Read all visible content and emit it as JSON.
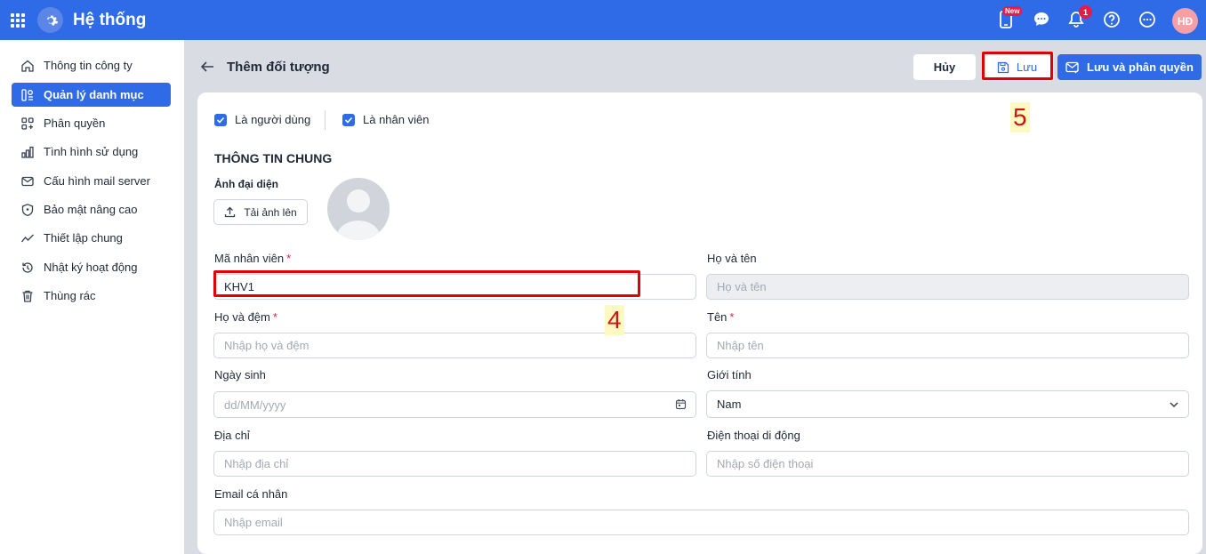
{
  "topbar": {
    "title": "Hệ thống",
    "new_badge": "New",
    "notification_count": "1",
    "user_initials": "HĐ"
  },
  "sidebar": {
    "items": [
      {
        "label": "Thông tin công ty",
        "icon": "home-icon"
      },
      {
        "label": "Quản lý danh mục",
        "icon": "category-icon",
        "active": true
      },
      {
        "label": "Phân quyền",
        "icon": "grid-plus-icon"
      },
      {
        "label": "Tình hình sử dụng",
        "icon": "bar-chart-icon"
      },
      {
        "label": "Cấu hình mail server",
        "icon": "mail-icon"
      },
      {
        "label": "Bảo mật nâng cao",
        "icon": "shield-icon"
      },
      {
        "label": "Thiết lập chung",
        "icon": "trend-icon"
      },
      {
        "label": "Nhật ký hoạt động",
        "icon": "history-icon"
      },
      {
        "label": "Thùng rác",
        "icon": "trash-icon"
      }
    ]
  },
  "header": {
    "title": "Thêm đối tượng",
    "cancel_label": "Hủy",
    "save_label": "Lưu",
    "save_perm_label": "Lưu và phân quyền"
  },
  "annotations": {
    "step4": "4",
    "step5": "5"
  },
  "form": {
    "is_user_label": "Là người dùng",
    "is_employee_label": "Là nhân viên",
    "is_user_checked": true,
    "is_employee_checked": true,
    "section_title": "THÔNG TIN CHUNG",
    "avatar_label": "Ảnh đại diện",
    "upload_label": "Tải ảnh lên",
    "employee_code": {
      "label": "Mã nhân viên",
      "value": "KHV1"
    },
    "full_name": {
      "label": "Họ và tên",
      "placeholder": "Họ và tên"
    },
    "last_middle_name": {
      "label": "Họ và đệm",
      "placeholder": "Nhập họ và đệm"
    },
    "first_name": {
      "label": "Tên",
      "placeholder": "Nhập tên"
    },
    "birthdate": {
      "label": "Ngày sinh",
      "placeholder": "dd/MM/yyyy"
    },
    "gender": {
      "label": "Giới tính",
      "value": "Nam"
    },
    "address": {
      "label": "Địa chỉ",
      "placeholder": "Nhập địa chỉ"
    },
    "mobile": {
      "label": "Điện thoại di động",
      "placeholder": "Nhập số điện thoại"
    },
    "email": {
      "label": "Email cá nhân",
      "placeholder": "Nhập email"
    }
  },
  "colors": {
    "primary": "#2f6be6",
    "highlight": "#e00000",
    "required": "#e11d48"
  }
}
